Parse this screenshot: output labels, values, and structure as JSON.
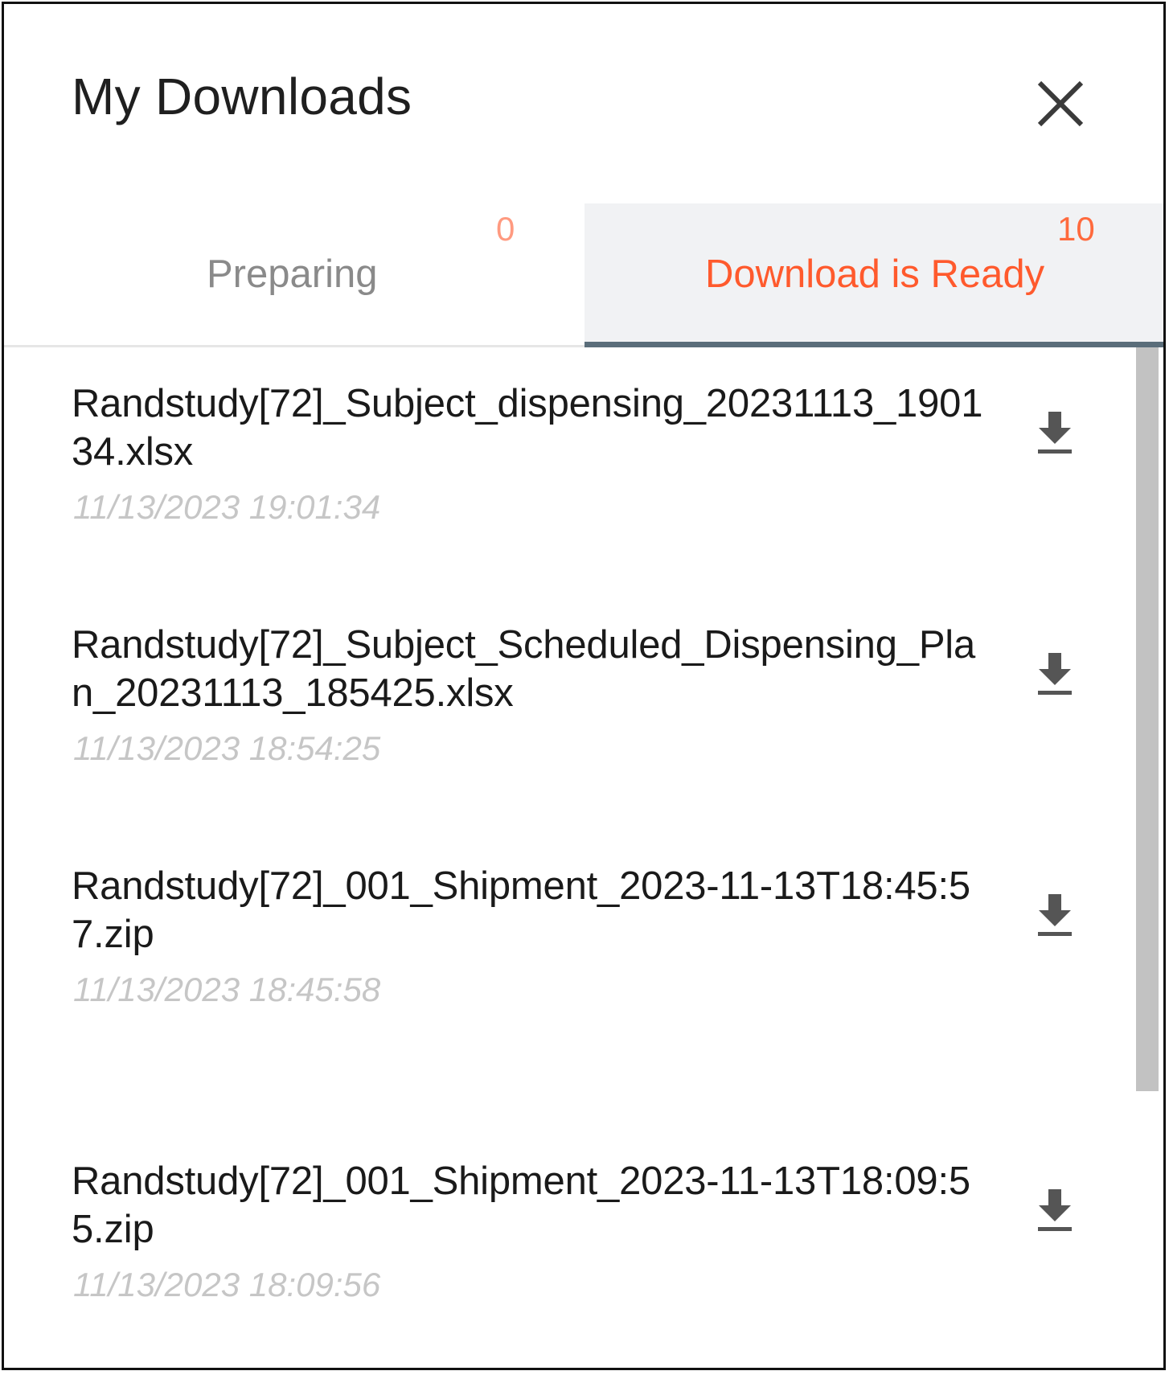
{
  "header": {
    "title": "My Downloads",
    "close_icon": "close-icon"
  },
  "tabs": [
    {
      "label": "Preparing",
      "count": "0",
      "active": false
    },
    {
      "label": "Download is Ready",
      "count": "10",
      "active": true
    }
  ],
  "colors": {
    "accent": "#ff5a2d",
    "active_tab_bg": "#f1f2f4",
    "active_tab_underline": "#5a6d7a",
    "timestamp": "#c6c6c6"
  },
  "downloads": [
    {
      "name": "Randstudy[72]_Subject_dispensing_20231113_190134.xlsx",
      "time": "11/13/2023 19:01:34",
      "icon": "download-icon"
    },
    {
      "name": "Randstudy[72]_Subject_Scheduled_Dispensing_Plan_20231113_185425.xlsx",
      "time": "11/13/2023 18:54:25",
      "icon": "download-icon"
    },
    {
      "name": "Randstudy[72]_001_Shipment_2023-11-13T18:45:57.zip",
      "time": "11/13/2023 18:45:58",
      "icon": "download-icon"
    },
    {
      "name": "Randstudy[72]_001_Shipment_2023-11-13T18:09:55.zip",
      "time": "11/13/2023 18:09:56",
      "icon": "download-icon"
    }
  ]
}
